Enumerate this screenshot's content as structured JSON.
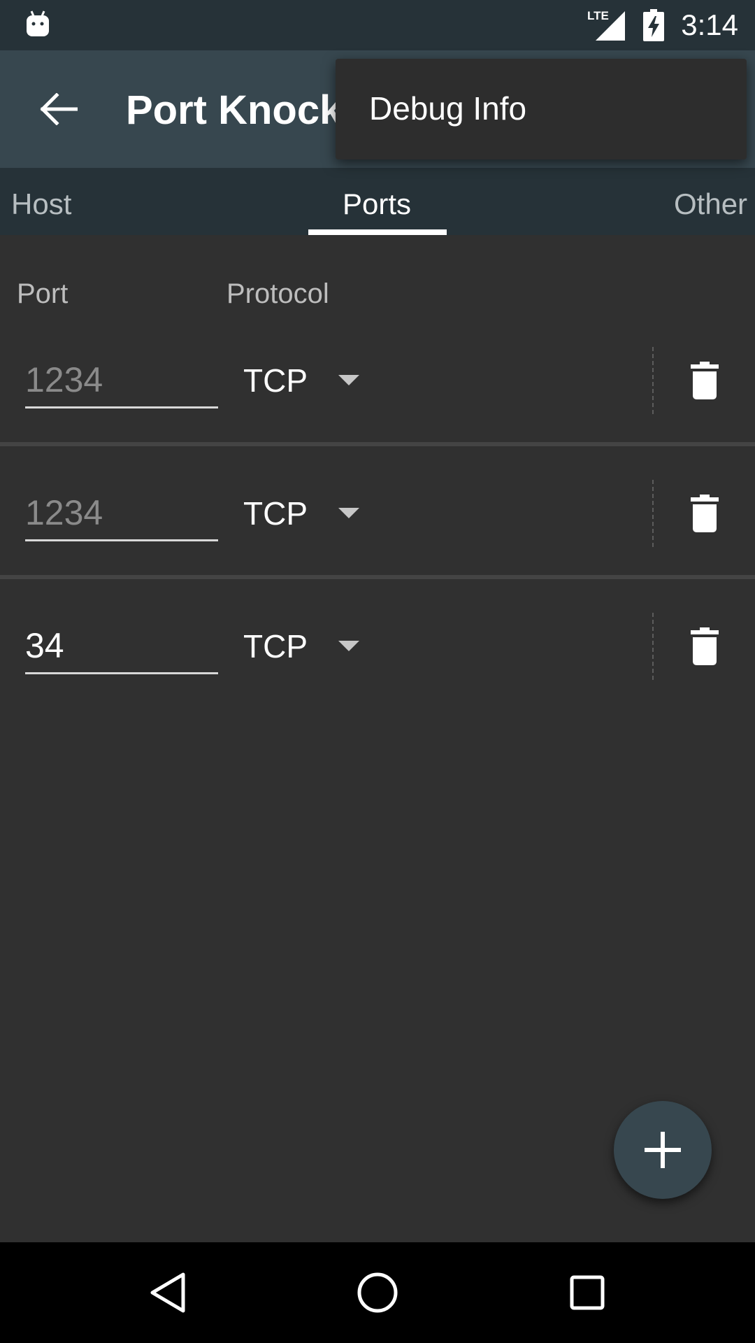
{
  "status_bar": {
    "time": "3:14",
    "network_label": "LTE",
    "icons": [
      "android-icon",
      "lte-signal-icon",
      "battery-charging-icon"
    ]
  },
  "app_bar": {
    "title": "Port Knocker",
    "back_icon": "arrow-back-icon"
  },
  "overflow_menu": {
    "items": [
      {
        "label": "Debug Info"
      }
    ]
  },
  "tabs": [
    {
      "label": "Host",
      "active": false
    },
    {
      "label": "Ports",
      "active": true
    },
    {
      "label": "Other",
      "active": false
    }
  ],
  "ports_list": {
    "headers": {
      "port": "Port",
      "protocol": "Protocol"
    },
    "rows": [
      {
        "port_value": "",
        "port_placeholder": "1234",
        "protocol": "TCP"
      },
      {
        "port_value": "",
        "port_placeholder": "1234",
        "protocol": "TCP"
      },
      {
        "port_value": "34",
        "port_placeholder": "1234",
        "protocol": "TCP"
      }
    ]
  },
  "fab": {
    "icon": "plus-icon"
  },
  "nav_bar": {
    "icons": [
      "nav-back-icon",
      "nav-home-icon",
      "nav-recents-icon"
    ]
  },
  "colors": {
    "status_bar": "#263238",
    "app_bar": "#37474f",
    "tabs": "#263238",
    "background": "#303030",
    "menu": "#2d2d2d",
    "fab": "#37474f"
  }
}
